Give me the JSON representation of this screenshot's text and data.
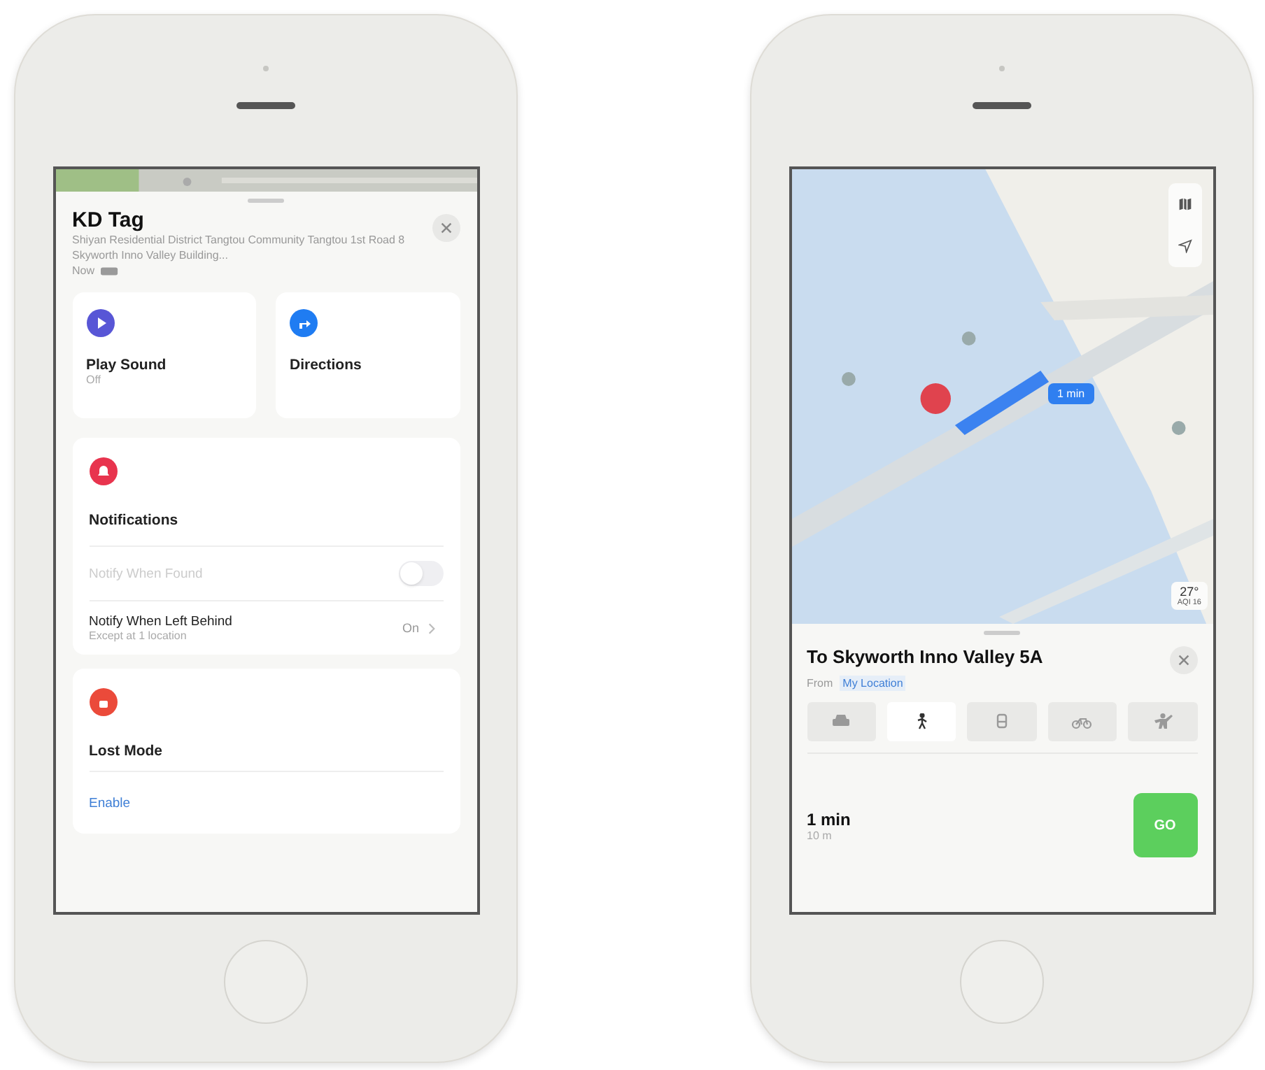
{
  "item_screen": {
    "title": "KD Tag",
    "address": "Shiyan Residential District Tangtou Community Tangtou 1st Road 8 Skyworth Inno Valley Building...",
    "updated": "Now",
    "actions": [
      {
        "kind": "sound",
        "label": "Play Sound",
        "status": "Off",
        "color": "#5856d6"
      },
      {
        "kind": "directions",
        "label": "Directions",
        "color": "#1f7cf2"
      }
    ],
    "notifications": {
      "title": "Notifications",
      "color": "#e8344e",
      "rows": [
        {
          "kind": "toggle",
          "label": "Notify When Found",
          "on": false,
          "disabled": true
        },
        {
          "kind": "link",
          "label": "Notify When Left Behind",
          "subtitle": "Except at 1 location",
          "value": "On",
          "disabled": false
        }
      ]
    },
    "lost_mode": {
      "title": "Lost Mode",
      "color": "#eb4a3a",
      "action": "Enable"
    }
  },
  "route_screen": {
    "route_badge": "1 min",
    "weather": {
      "temperature": "27°",
      "aqi": "AQI 16"
    },
    "title": "To Skyworth Inno Valley 5A",
    "from_label": "From",
    "from_value": "My Location",
    "modes": [
      {
        "kind": "car",
        "selected": false
      },
      {
        "kind": "walk",
        "selected": true
      },
      {
        "kind": "transit",
        "selected": false
      },
      {
        "kind": "bike",
        "selected": false
      },
      {
        "kind": "ride",
        "selected": false
      }
    ],
    "route": {
      "time": "1 min",
      "distance": "10 m",
      "go": "GO"
    }
  }
}
